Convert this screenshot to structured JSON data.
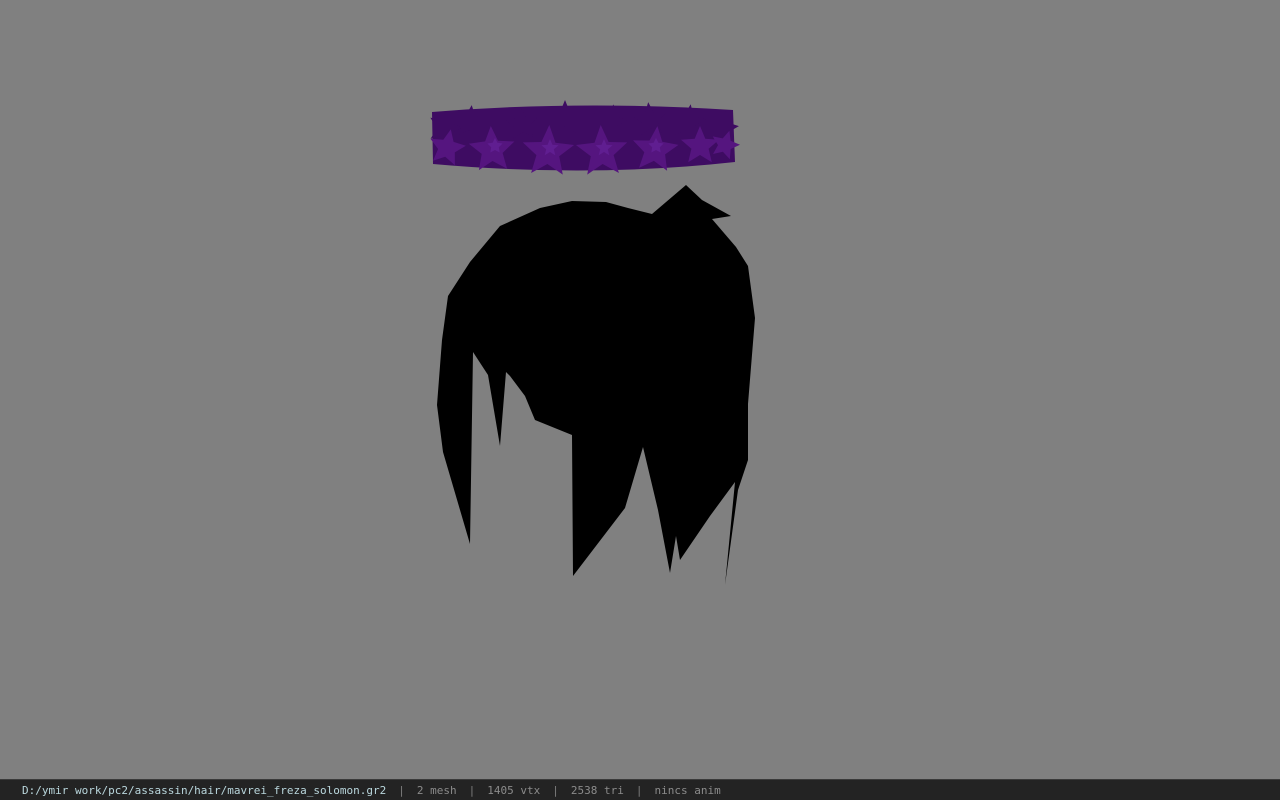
{
  "viewport": {
    "background_color": "#808080",
    "model": {
      "hair_color": "#000000",
      "crown_color": "#55157f",
      "crown_shadow_color": "#3e0c62",
      "crown_highlight_color": "#6a26a0"
    }
  },
  "status_bar": {
    "file_path": "D:/ymir work/pc2/assassin/hair/mavrei_freza_solomon.gr2",
    "separator": "|",
    "mesh_count": "2 mesh",
    "vertex_count": "1405 vtx",
    "triangle_count": "2538 tri",
    "anim_status": "nincs anim"
  }
}
